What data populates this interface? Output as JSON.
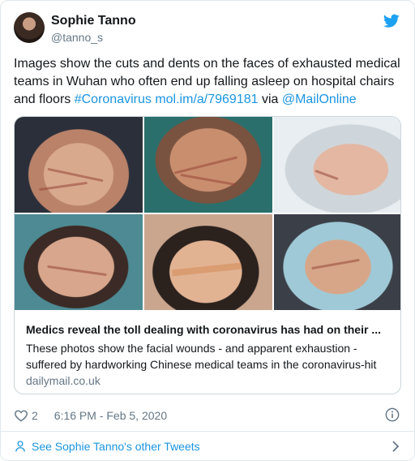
{
  "author": {
    "name": "Sophie Tanno",
    "handle": "@tanno_s"
  },
  "tweet": {
    "text_plain": "Images show the cuts and dents on the faces of exhausted medical teams in Wuhan who often end up falling asleep on hospital chairs and floors ",
    "hashtag": "#Coronavirus",
    "url": "mol.im/a/7969181",
    "via": " via ",
    "mention": "@MailOnline"
  },
  "card": {
    "title": "Medics reveal the toll dealing with coronavirus has had on their ...",
    "description": "These photos show the facial wounds - and apparent exhaustion - suffered by hardworking Chinese medical teams in the coronavirus-hit",
    "domain": "dailymail.co.uk"
  },
  "meta": {
    "likes": "2",
    "timestamp": "6:16 PM - Feb 5, 2020"
  },
  "footer": {
    "other_tweets": "See Sophie Tanno's other Tweets"
  },
  "icons": {
    "brand": "twitter-bird-icon",
    "like": "heart-icon",
    "info": "info-icon",
    "person": "person-icon",
    "chevron": "chevron-right-icon"
  },
  "colors": {
    "link": "#1b95e0",
    "text": "#14171a",
    "muted": "#657786",
    "border": "#e1e8ed"
  }
}
